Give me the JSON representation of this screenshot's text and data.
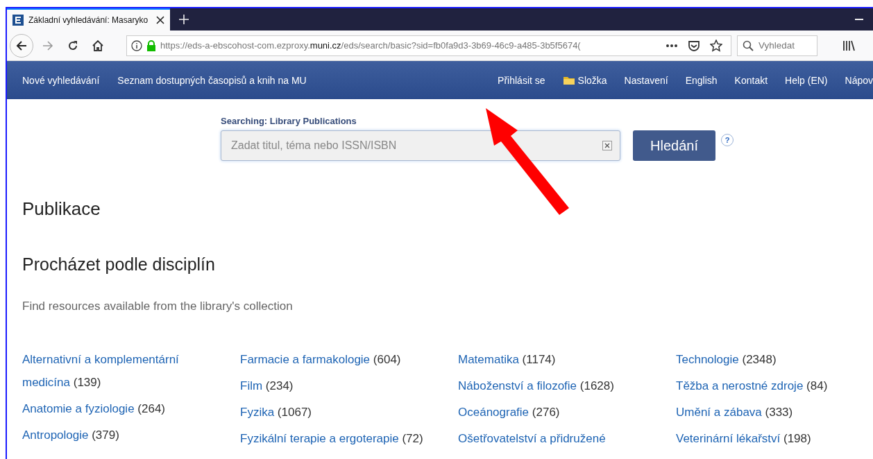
{
  "browser": {
    "tab": {
      "title": "Základní vyhledávání: Masaryko",
      "selected": true
    },
    "address": {
      "url_pre": "https://eds-a-ebscohost-com.ezproxy.",
      "url_domain": "muni.cz",
      "url_post": "/eds/search/basic?sid=fb0fa9d3-3b69-46c9-a485-3b5f5674("
    },
    "search": {
      "placeholder": "Vyhledat"
    }
  },
  "nav": {
    "left": [
      "Nové vyhledávání",
      "Seznam dostupných časopisů a knih na MU"
    ],
    "right": [
      {
        "label": "Přihlásit se",
        "kind": "text"
      },
      {
        "label": "Složka",
        "kind": "folder"
      },
      {
        "label": "Nastavení",
        "kind": "text"
      },
      {
        "label": "English",
        "kind": "text"
      },
      {
        "label": "Kontakt",
        "kind": "text"
      },
      {
        "label": "Help (EN)",
        "kind": "text"
      },
      {
        "label": "Nápov",
        "kind": "text"
      }
    ]
  },
  "search": {
    "label": "Searching: Library Publications",
    "placeholder": "Zadat titul, téma nebo ISSN/ISBN",
    "button": "Hledání",
    "help": "?"
  },
  "heading": "Publikace",
  "subheading": "Procházet podle disciplín",
  "intro": "Find resources available from the library's collection",
  "subjects": [
    [
      {
        "name": "Alternativní a komplementární medicína",
        "count": "(139)"
      },
      {
        "name": "Anatomie a fyziologie",
        "count": "(264)"
      },
      {
        "name": "Antropologie",
        "count": "(379)"
      }
    ],
    [
      {
        "name": "Farmacie a farmakologie",
        "count": "(604)"
      },
      {
        "name": "Film",
        "count": "(234)"
      },
      {
        "name": "Fyzika",
        "count": "(1067)"
      },
      {
        "name": "Fyzikální terapie a ergoterapie",
        "count": "(72)"
      }
    ],
    [
      {
        "name": "Matematika",
        "count": "(1174)"
      },
      {
        "name": "Náboženství a filozofie",
        "count": "(1628)"
      },
      {
        "name": "Oceánografie",
        "count": "(276)"
      },
      {
        "name": "Ošetřovatelství a přidružené"
      }
    ],
    [
      {
        "name": "Technologie",
        "count": "(2348)"
      },
      {
        "name": "Těžba a nerostné zdroje",
        "count": "(84)"
      },
      {
        "name": "Umění a zábava",
        "count": "(333)"
      },
      {
        "name": "Veterinární lékařství",
        "count": "(198)"
      }
    ]
  ]
}
